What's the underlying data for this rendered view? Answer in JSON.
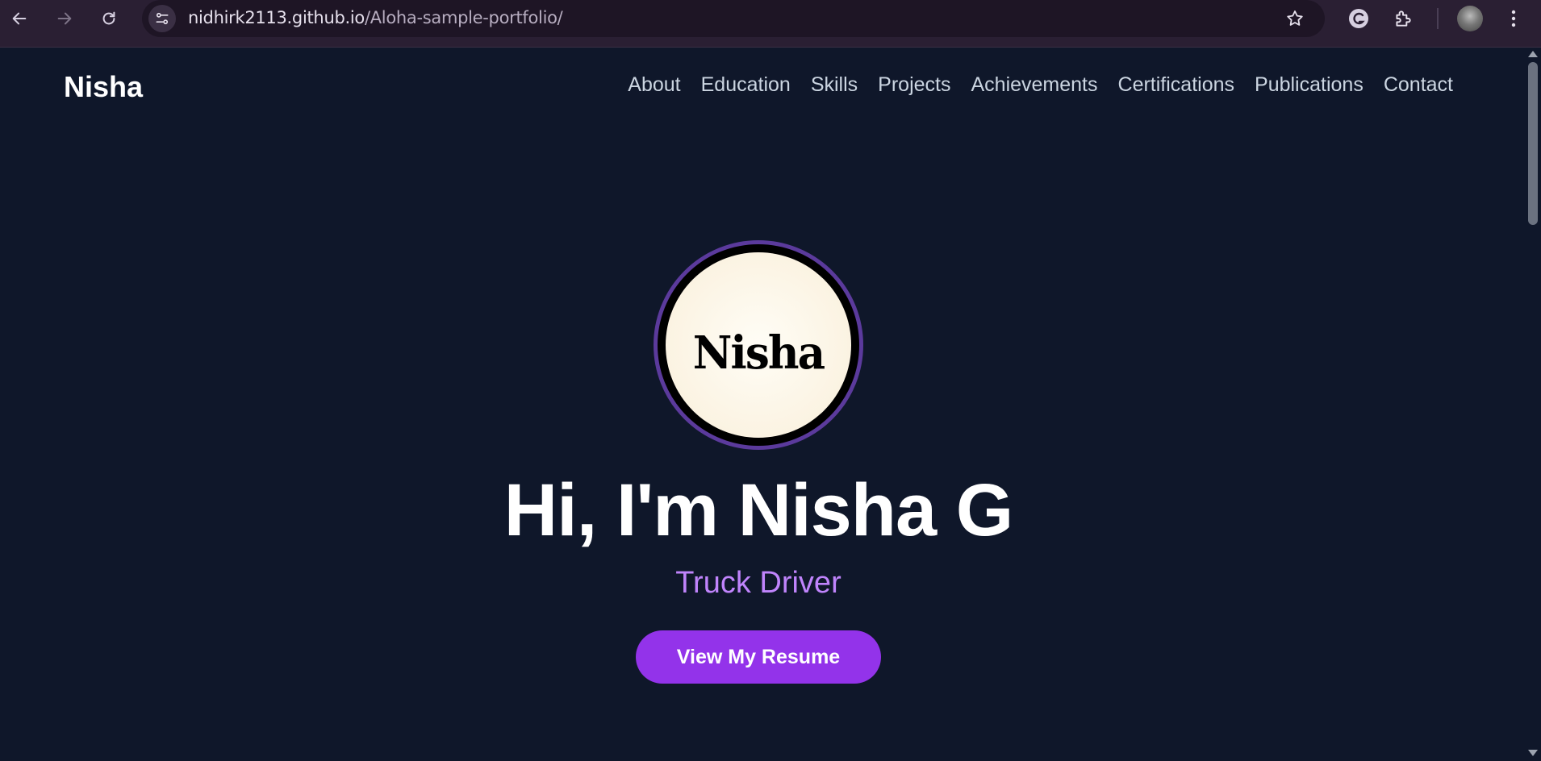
{
  "browser": {
    "url_host": "nidhirk2113.github.io",
    "url_path": "/Aloha-sample-portfolio/",
    "icons": {
      "back": "arrow-left-icon",
      "forward": "arrow-right-icon",
      "reload": "reload-icon",
      "site_info": "tune-icon",
      "bookmark": "star-icon",
      "grammarly": "grammarly-icon",
      "extensions": "puzzle-icon",
      "profile": "avatar",
      "menu": "kebab-icon"
    }
  },
  "header": {
    "brand": "Nisha",
    "nav": [
      "About",
      "Education",
      "Skills",
      "Projects",
      "Achievements",
      "Certifications",
      "Publications",
      "Contact"
    ]
  },
  "hero": {
    "logo_text": "Nisha",
    "title": "Hi, I'm Nisha G",
    "subtitle": "Truck Driver",
    "cta_label": "View My Resume"
  },
  "colors": {
    "page_bg": "#0f172a",
    "accent": "#9333ea",
    "subtitle": "#c084fc",
    "ring": "#5b3a9c",
    "nav_text": "#cbd5e1",
    "chrome_bg": "#2a1f33"
  }
}
